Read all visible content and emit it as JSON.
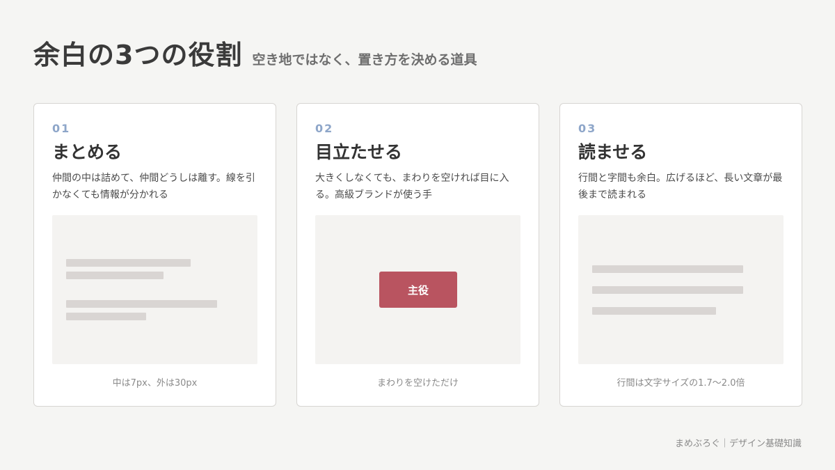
{
  "header": {
    "title": "余白の3つの役割",
    "subtitle": "空き地ではなく、置き方を決める道具"
  },
  "cards": [
    {
      "num": "01",
      "title": "まとめる",
      "desc": "仲間の中は詰めて、仲間どうしは離す。線を引かなくても情報が分かれる",
      "caption": "中は7px、外は30px"
    },
    {
      "num": "02",
      "title": "目立たせる",
      "desc": "大きくしなくても、まわりを空ければ目に入る。高級ブランドが使う手",
      "button_label": "主役",
      "caption": "まわりを空けただけ"
    },
    {
      "num": "03",
      "title": "読ませる",
      "desc": "行間と字間も余白。広げるほど、長い文章が最後まで読まれる",
      "caption": "行間は文字サイズの1.7〜2.0倍"
    }
  ],
  "footer": "まめぶろぐ｜デザイン基礎知識",
  "colors": {
    "accent_number": "#8ea6c9",
    "button": "#b95460",
    "placeholder_bar": "#d9d5d3",
    "background": "#f5f5f3"
  }
}
